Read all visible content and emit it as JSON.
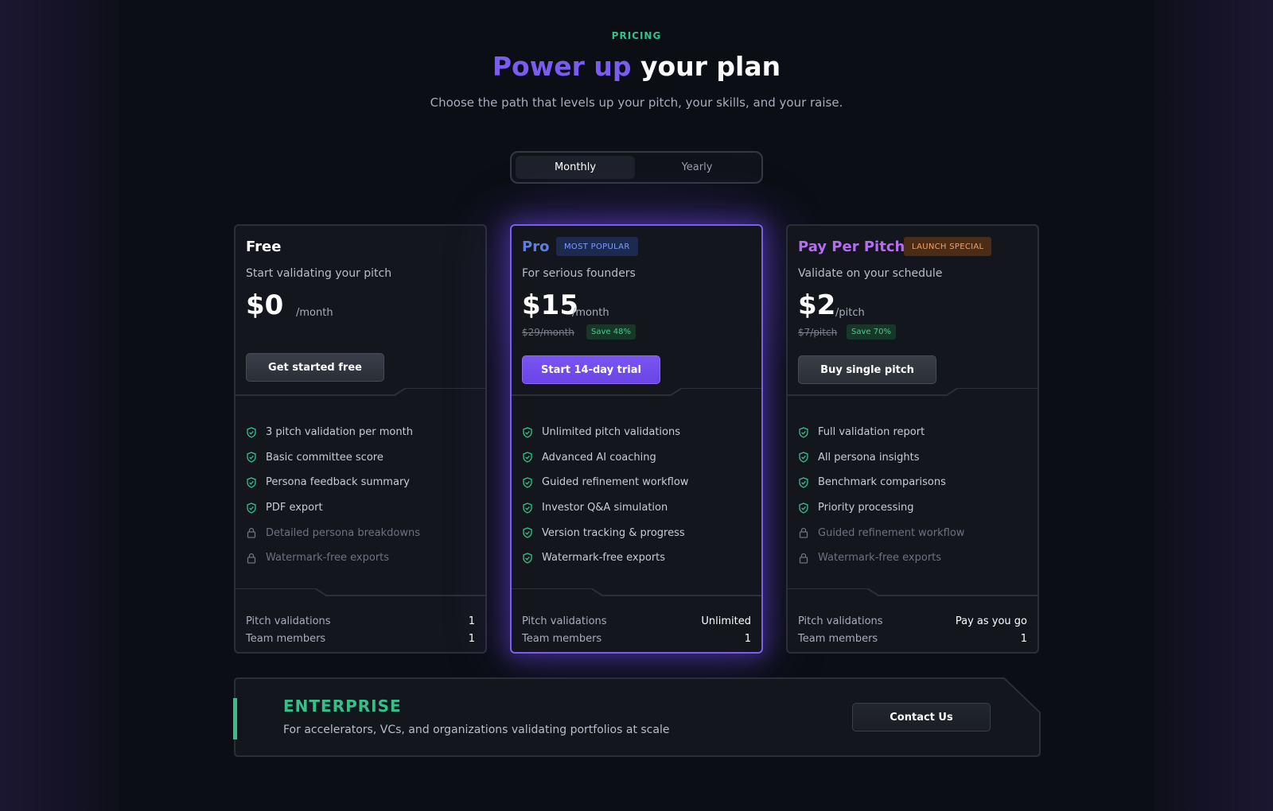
{
  "header": {
    "eyebrow": "PRICING",
    "title_accent": "Power up",
    "title_rest": "your plan",
    "subtitle": "Choose the path that levels up your pitch, your skills, and your raise."
  },
  "billing_toggle": {
    "options": [
      "Monthly",
      "Yearly"
    ],
    "selected": "Monthly"
  },
  "colors": {
    "accent_purple": "#7b5cf0",
    "accent_green": "#35c08a",
    "pro_name": "#5b7fe0",
    "ppp_name": "#b56cf0"
  },
  "plans": [
    {
      "name": "Free",
      "description": "Start validating your pitch",
      "price": "$0",
      "period": "/month",
      "cta": "Get started free",
      "features": [
        {
          "label": "3 pitch validation per month",
          "icon": "check-circle-icon",
          "included": true
        },
        {
          "label": "Basic committee score",
          "icon": "check-circle-icon",
          "included": true
        },
        {
          "label": "Persona feedback summary",
          "icon": "check-circle-icon",
          "included": true
        },
        {
          "label": "PDF export",
          "icon": "check-circle-icon",
          "included": true
        },
        {
          "label": "Detailed persona breakdowns",
          "icon": "lock-icon",
          "included": false
        },
        {
          "label": "Watermark-free exports",
          "icon": "lock-icon",
          "included": false
        }
      ],
      "stats": [
        {
          "label": "Pitch validations",
          "value": "1"
        },
        {
          "label": "Team members",
          "value": "1"
        }
      ]
    },
    {
      "name": "Pro",
      "badge": "MOST POPULAR",
      "description": "For serious founders",
      "price": "$15",
      "period": "/month",
      "old_price": "$29/month",
      "save": "Save 48%",
      "cta": "Start 14-day trial",
      "features": [
        {
          "label": "Unlimited pitch validations",
          "icon": "check-circle-icon",
          "included": true
        },
        {
          "label": "Advanced AI coaching",
          "icon": "check-circle-icon",
          "included": true
        },
        {
          "label": "Guided refinement workflow",
          "icon": "check-circle-icon",
          "included": true
        },
        {
          "label": "Investor Q&A simulation",
          "icon": "check-circle-icon",
          "included": true
        },
        {
          "label": "Version tracking & progress",
          "icon": "check-circle-icon",
          "included": true
        },
        {
          "label": "Watermark-free exports",
          "icon": "check-circle-icon",
          "included": true
        }
      ],
      "stats": [
        {
          "label": "Pitch validations",
          "value": "Unlimited"
        },
        {
          "label": "Team members",
          "value": "1"
        }
      ]
    },
    {
      "name": "Pay Per Pitch",
      "badge": "LAUNCH SPECIAL",
      "description": "Validate on your schedule",
      "price": "$2",
      "period": "/pitch",
      "old_price": "$7/pitch",
      "save": "Save 70%",
      "cta": "Buy single pitch",
      "features": [
        {
          "label": "Full validation report",
          "icon": "check-circle-icon",
          "included": true
        },
        {
          "label": "All persona insights",
          "icon": "check-circle-icon",
          "included": true
        },
        {
          "label": "Benchmark comparisons",
          "icon": "check-circle-icon",
          "included": true
        },
        {
          "label": "Priority processing",
          "icon": "check-circle-icon",
          "included": true
        },
        {
          "label": "Guided refinement workflow",
          "icon": "lock-icon",
          "included": false
        },
        {
          "label": "Watermark-free exports",
          "icon": "lock-icon",
          "included": false
        }
      ],
      "stats": [
        {
          "label": "Pitch validations",
          "value": "Pay as you go"
        },
        {
          "label": "Team members",
          "value": "1"
        }
      ]
    }
  ],
  "enterprise": {
    "title": "ENTERPRISE",
    "description": "For accelerators, VCs, and organizations validating portfolios at scale",
    "cta": "Contact Us"
  }
}
